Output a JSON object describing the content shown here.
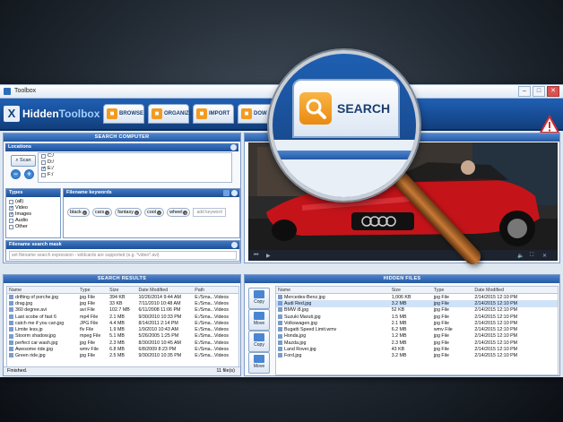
{
  "window": {
    "title": "Toolbox",
    "min": "–",
    "max": "□",
    "close": "✕"
  },
  "app": {
    "logo_part1": "Hidden",
    "logo_part2": "Toolbox",
    "logo_glyph": "X",
    "tabs": [
      {
        "label": "BROWSE",
        "icon": "browse-icon"
      },
      {
        "label": "ORGANIZE",
        "icon": "organize-icon"
      },
      {
        "label": "IMPORT",
        "icon": "import-icon"
      },
      {
        "label": "DOW",
        "icon": "download-icon"
      }
    ],
    "alert_icon": "warning-icon",
    "accent": "#1f5fb4",
    "tab_icon_color": "#f39b21"
  },
  "search_computer": {
    "title": "SEARCH COMPUTER",
    "locations_label": "Locations",
    "scan_label": "Scan",
    "drives": [
      {
        "label": "C:/",
        "checked": false
      },
      {
        "label": "D:/",
        "checked": false
      },
      {
        "label": "E:/",
        "checked": true
      },
      {
        "label": "F:/",
        "checked": false
      }
    ],
    "types_label": "Types",
    "types": [
      {
        "label": "(all)",
        "checked": false
      },
      {
        "label": "Video",
        "checked": true
      },
      {
        "label": "Images",
        "checked": true
      },
      {
        "label": "Audio",
        "checked": false
      },
      {
        "label": "Other",
        "checked": false
      }
    ],
    "keywords_label": "Filename keywords",
    "keywords": [
      "black",
      "cars",
      "fantasy",
      "cool",
      "wheel"
    ],
    "add_keyword_placeholder": "add keyword",
    "mask_label": "Filename search mask",
    "mask_placeholder": "set filename search expression - wildcards are supported (e.g. *video*.avi)"
  },
  "preview": {
    "title": "W"
  },
  "search_results": {
    "title": "SEARCH RESULTS",
    "columns": [
      "Name",
      "Type",
      "Size",
      "Date Modified",
      "Path"
    ],
    "rows": [
      [
        "drifting of porche.jpg",
        "jpg File",
        "394 KB",
        "10/26/2014 9:44 AM",
        "E:/Sma...Videos"
      ],
      [
        "drag.jpg",
        "jpg File",
        "33 KB",
        "7/11/2010 10:48 AM",
        "E:/Sma...Videos"
      ],
      [
        "360 degree.avi",
        "avi File",
        "102.7 MB",
        "6/11/2008 11:06 PM",
        "E:/Sma...Videos"
      ],
      [
        "Last scobe of fast 6",
        "mp4 File",
        "2.1 MB",
        "9/30/2010 10:33 PM",
        "E:/Sma...Videos"
      ],
      [
        "catch me if you can.jpg",
        "JPG File",
        "4.4 MB",
        "8/14/2011 2:14 PM",
        "E:/Sma...Videos"
      ],
      [
        "Limite less.jp",
        "flv File",
        "1.9 MB",
        "1/9/2010 10:43 AM",
        "E:/Sma...Videos"
      ],
      [
        "Stoorm shadow.jpg",
        "mpeg File",
        "5.1 MB",
        "5/26/2005 1:25 PM",
        "E:/Sma...Videos"
      ],
      [
        "perfect car wash.jpg",
        "jpg File",
        "2.3 MB",
        "8/30/2010 10:45 AM",
        "E:/Sma...Videos"
      ],
      [
        "Awesome ride.jpg",
        "wmv File",
        "6.8 MB",
        "6/8/2009 8:23 PM",
        "E:/Sma...Videos"
      ],
      [
        "Green ride.jpg",
        "jpg File",
        "2.5 MB",
        "9/30/2010 10:35 PM",
        "E:/Sma...Videos"
      ]
    ],
    "status_left": "Finished.",
    "status_right": "11 file(s)"
  },
  "hidden_files": {
    "title": "HIDDEN FILES",
    "side_buttons": [
      {
        "label": "Copy",
        "icon": "copy-icon"
      },
      {
        "label": "Move",
        "icon": "move-icon"
      },
      {
        "label": "Copy",
        "icon": "copy-icon"
      },
      {
        "label": "Move",
        "icon": "move-icon"
      }
    ],
    "columns": [
      "Name",
      "Size",
      "Type",
      "Date Modified"
    ],
    "rows": [
      [
        "Mercedes-Benz.jpg",
        "1,006 KB",
        "jpg File",
        "2/14/2015 12:10 PM"
      ],
      [
        "Audi Red.jpg",
        "3.2 MB",
        "jpg File",
        "2/14/2015 12:10 PM"
      ],
      [
        "BMW i8.jpg",
        "52 KB",
        "jpg File",
        "2/14/2015 12:10 PM"
      ],
      [
        "Suzuki Maruti.jpg",
        "1.5 MB",
        "jpg File",
        "2/14/2015 12:10 PM"
      ],
      [
        "Volkswagen.jpg",
        "2.1 MB",
        "jpg File",
        "2/14/2015 12:10 PM"
      ],
      [
        "Bugatti Speed Limit.wmv",
        "6.2 MB",
        "wmv File",
        "2/14/2015 12:10 PM"
      ],
      [
        "Honda.jpg",
        "1.2 MB",
        "jpg File",
        "2/14/2015 12:10 PM"
      ],
      [
        "Mazda.jpg",
        "2.3 MB",
        "jpg File",
        "2/14/2015 12:10 PM"
      ],
      [
        "Land Rover.jpg",
        "43 KB",
        "jpg File",
        "2/14/2015 12:10 PM"
      ],
      [
        "Ford.jpg",
        "3.2 MB",
        "jpg File",
        "2/14/2015 12:10 PM"
      ]
    ],
    "selected_row": 1
  },
  "magnifier": {
    "label": "SEARCH",
    "icon": "search-icon"
  }
}
